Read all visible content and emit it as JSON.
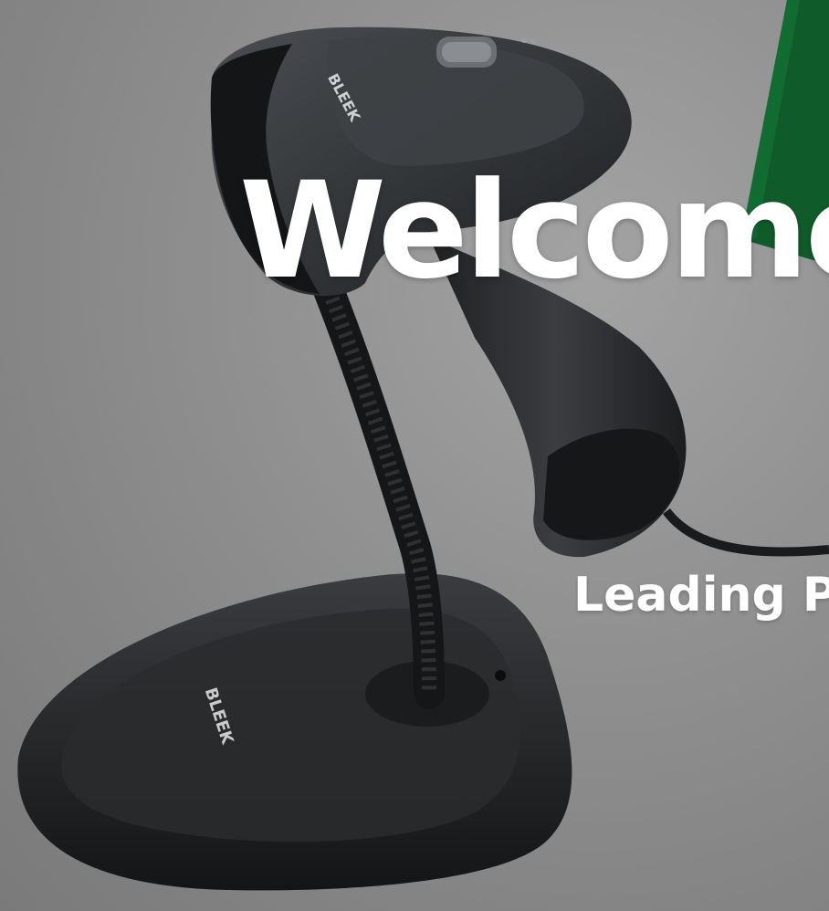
{
  "hero": {
    "headline": "Welcome",
    "tagline": "Leading P",
    "brand_mark": "BLEEK"
  },
  "colors": {
    "background": "#8f8f8f",
    "accent_green": "#0f5c2a",
    "scanner_body": "#2b2d30",
    "text": "#ffffff"
  },
  "icons": [
    "barcode-scanner-image",
    "scanner-stand-image"
  ]
}
